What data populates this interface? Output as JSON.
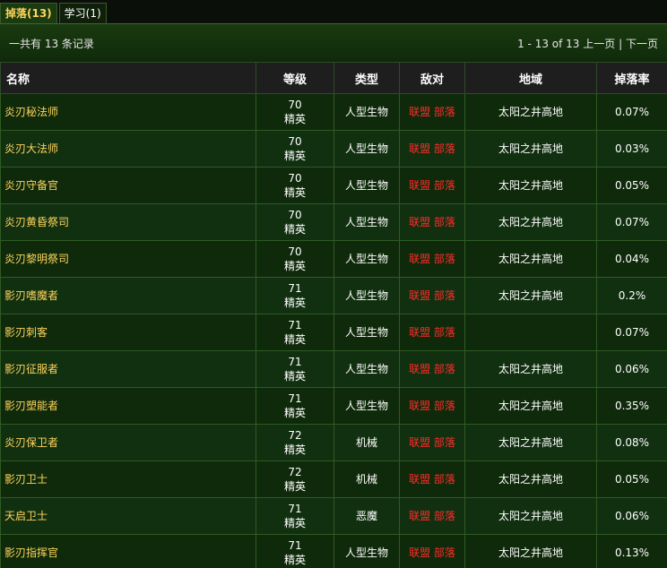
{
  "tabs": [
    {
      "label": "掉落(13)",
      "active": true
    },
    {
      "label": "学习(1)",
      "active": false
    }
  ],
  "summary": "一共有 13 条记录",
  "pager": {
    "range": "1 - 13 of 13",
    "prev": "上一页",
    "separator": "|",
    "next": "下一页"
  },
  "columns": [
    "名称",
    "等级",
    "类型",
    "敌对",
    "地域",
    "掉落率"
  ],
  "rows": [
    {
      "name": "炎刃秘法师",
      "level": "70",
      "rank": "精英",
      "type": "人型生物",
      "alliance": "联盟",
      "horde": "部落",
      "zone": "太阳之井高地",
      "rate": "0.07%"
    },
    {
      "name": "炎刃大法师",
      "level": "70",
      "rank": "精英",
      "type": "人型生物",
      "alliance": "联盟",
      "horde": "部落",
      "zone": "太阳之井高地",
      "rate": "0.03%"
    },
    {
      "name": "炎刃守备官",
      "level": "70",
      "rank": "精英",
      "type": "人型生物",
      "alliance": "联盟",
      "horde": "部落",
      "zone": "太阳之井高地",
      "rate": "0.05%"
    },
    {
      "name": "炎刃黄昏祭司",
      "level": "70",
      "rank": "精英",
      "type": "人型生物",
      "alliance": "联盟",
      "horde": "部落",
      "zone": "太阳之井高地",
      "rate": "0.07%"
    },
    {
      "name": "炎刃黎明祭司",
      "level": "70",
      "rank": "精英",
      "type": "人型生物",
      "alliance": "联盟",
      "horde": "部落",
      "zone": "太阳之井高地",
      "rate": "0.04%"
    },
    {
      "name": "影刃嗜魔者",
      "level": "71",
      "rank": "精英",
      "type": "人型生物",
      "alliance": "联盟",
      "horde": "部落",
      "zone": "太阳之井高地",
      "rate": "0.2%"
    },
    {
      "name": "影刃刺客",
      "level": "71",
      "rank": "精英",
      "type": "人型生物",
      "alliance": "联盟",
      "horde": "部落",
      "zone": "",
      "rate": "0.07%"
    },
    {
      "name": "影刃征服者",
      "level": "71",
      "rank": "精英",
      "type": "人型生物",
      "alliance": "联盟",
      "horde": "部落",
      "zone": "太阳之井高地",
      "rate": "0.06%"
    },
    {
      "name": "影刃塑能者",
      "level": "71",
      "rank": "精英",
      "type": "人型生物",
      "alliance": "联盟",
      "horde": "部落",
      "zone": "太阳之井高地",
      "rate": "0.35%"
    },
    {
      "name": "炎刃保卫者",
      "level": "72",
      "rank": "精英",
      "type": "机械",
      "alliance": "联盟",
      "horde": "部落",
      "zone": "太阳之井高地",
      "rate": "0.08%"
    },
    {
      "name": "影刃卫士",
      "level": "72",
      "rank": "精英",
      "type": "机械",
      "alliance": "联盟",
      "horde": "部落",
      "zone": "太阳之井高地",
      "rate": "0.05%"
    },
    {
      "name": "天启卫士",
      "level": "71",
      "rank": "精英",
      "type": "恶魔",
      "alliance": "联盟",
      "horde": "部落",
      "zone": "太阳之井高地",
      "rate": "0.06%"
    },
    {
      "name": "影刃指挥官",
      "level": "71",
      "rank": "精英",
      "type": "人型生物",
      "alliance": "联盟",
      "horde": "部落",
      "zone": "太阳之井高地",
      "rate": "0.13%"
    }
  ]
}
